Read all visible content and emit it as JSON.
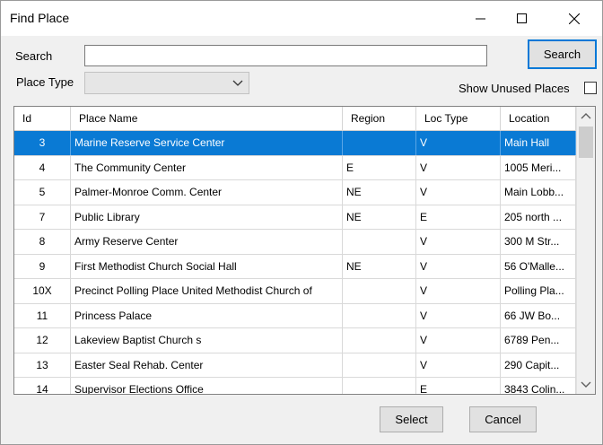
{
  "window": {
    "title": "Find Place"
  },
  "search": {
    "label": "Search",
    "value": "",
    "placeholder": "",
    "button_label": "Search"
  },
  "place_type": {
    "label": "Place Type",
    "value": ""
  },
  "show_unused": {
    "label": "Show Unused Places",
    "checked": false
  },
  "grid": {
    "columns": [
      "Id",
      "Place Name",
      "Region",
      "Loc Type",
      "Location"
    ],
    "rows": [
      {
        "id": "3",
        "name": "Marine Reserve Service Center",
        "region": "",
        "loc_type": "V",
        "location": "Main Hall",
        "selected": true
      },
      {
        "id": "4",
        "name": "The Community Center",
        "region": "E",
        "loc_type": "V",
        "location": "1005 Meri..."
      },
      {
        "id": "5",
        "name": "Palmer-Monroe Comm. Center",
        "region": "NE",
        "loc_type": "V",
        "location": "Main Lobb..."
      },
      {
        "id": "7",
        "name": "Public Library",
        "region": "NE",
        "loc_type": "E",
        "location": "205 north ..."
      },
      {
        "id": "8",
        "name": "Army Reserve Center",
        "region": "",
        "loc_type": "V",
        "location": "300 M Str..."
      },
      {
        "id": "9",
        "name": "First Methodist Church Social Hall",
        "region": "NE",
        "loc_type": "V",
        "location": "56 O'Malle..."
      },
      {
        "id": "10X",
        "name": "Precinct Polling Place United Methodist Church of",
        "region": "",
        "loc_type": "V",
        "location": "Polling Pla..."
      },
      {
        "id": "11",
        "name": "Princess Palace",
        "region": "",
        "loc_type": "V",
        "location": "66 JW Bo..."
      },
      {
        "id": "12",
        "name": "Lakeview Baptist Church s",
        "region": "",
        "loc_type": "V",
        "location": "6789 Pen..."
      },
      {
        "id": "13",
        "name": "Easter Seal Rehab. Center",
        "region": "",
        "loc_type": "V",
        "location": "290 Capit..."
      },
      {
        "id": "14",
        "name": "Supervisor Elections Office",
        "region": "",
        "loc_type": "E",
        "location": "3843 Colin..."
      }
    ]
  },
  "footer": {
    "select_label": "Select",
    "cancel_label": "Cancel"
  },
  "colors": {
    "selection": "#0a7ad4",
    "focus_border": "#0078d7"
  }
}
